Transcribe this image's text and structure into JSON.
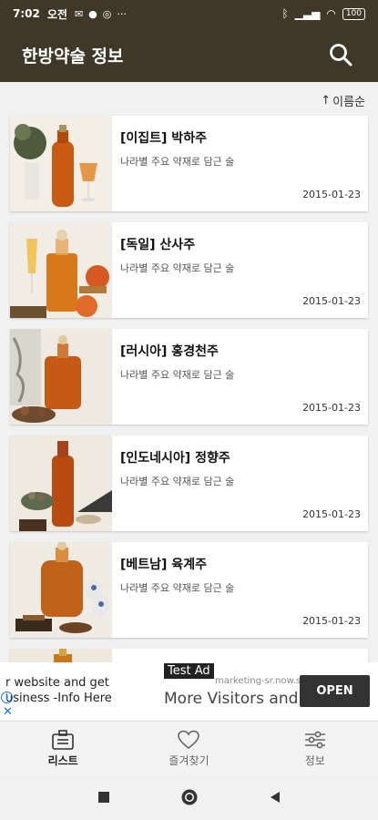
{
  "status_bar": {
    "time": "7:02",
    "ampm": "오전",
    "battery": "100",
    "more": "···"
  },
  "app_bar": {
    "title": "한방약술 정보"
  },
  "sort": {
    "label": "이름순",
    "arrow": "↑"
  },
  "items": [
    {
      "title": "[이집트] 박하주",
      "subtitle": "나라별 주요 약재로 담근 술",
      "date": "2015-01-23"
    },
    {
      "title": "[독일] 산사주",
      "subtitle": "나라별 주요 약재로 담근 술",
      "date": "2015-01-23"
    },
    {
      "title": "[러시아] 홍경천주",
      "subtitle": "나라별 주요 약재로 담근 술",
      "date": "2015-01-23"
    },
    {
      "title": "[인도네시아] 정향주",
      "subtitle": "나라별 주요 약재로 담근 술",
      "date": "2015-01-23"
    },
    {
      "title": "[베트남] 육계주",
      "subtitle": "나라별 주요 약재로 담근 술",
      "date": "2015-01-23"
    }
  ],
  "ad": {
    "tag": "Test Ad",
    "left_line1": "r website and get",
    "left_line2": "usiness -Info Here",
    "url": "marketing-sr.now.site",
    "headline": "More Visitors and",
    "open_label": "OPEN"
  },
  "bottom_nav": [
    {
      "label": "리스트",
      "icon": "briefcase-icon",
      "active": true
    },
    {
      "label": "즐겨찾기",
      "icon": "heart-icon",
      "active": false
    },
    {
      "label": "정보",
      "icon": "sliders-icon",
      "active": false
    }
  ],
  "colors": {
    "app_bar": "#3f3828",
    "accent_text": "#ffffff",
    "amber": "#c85a12"
  }
}
